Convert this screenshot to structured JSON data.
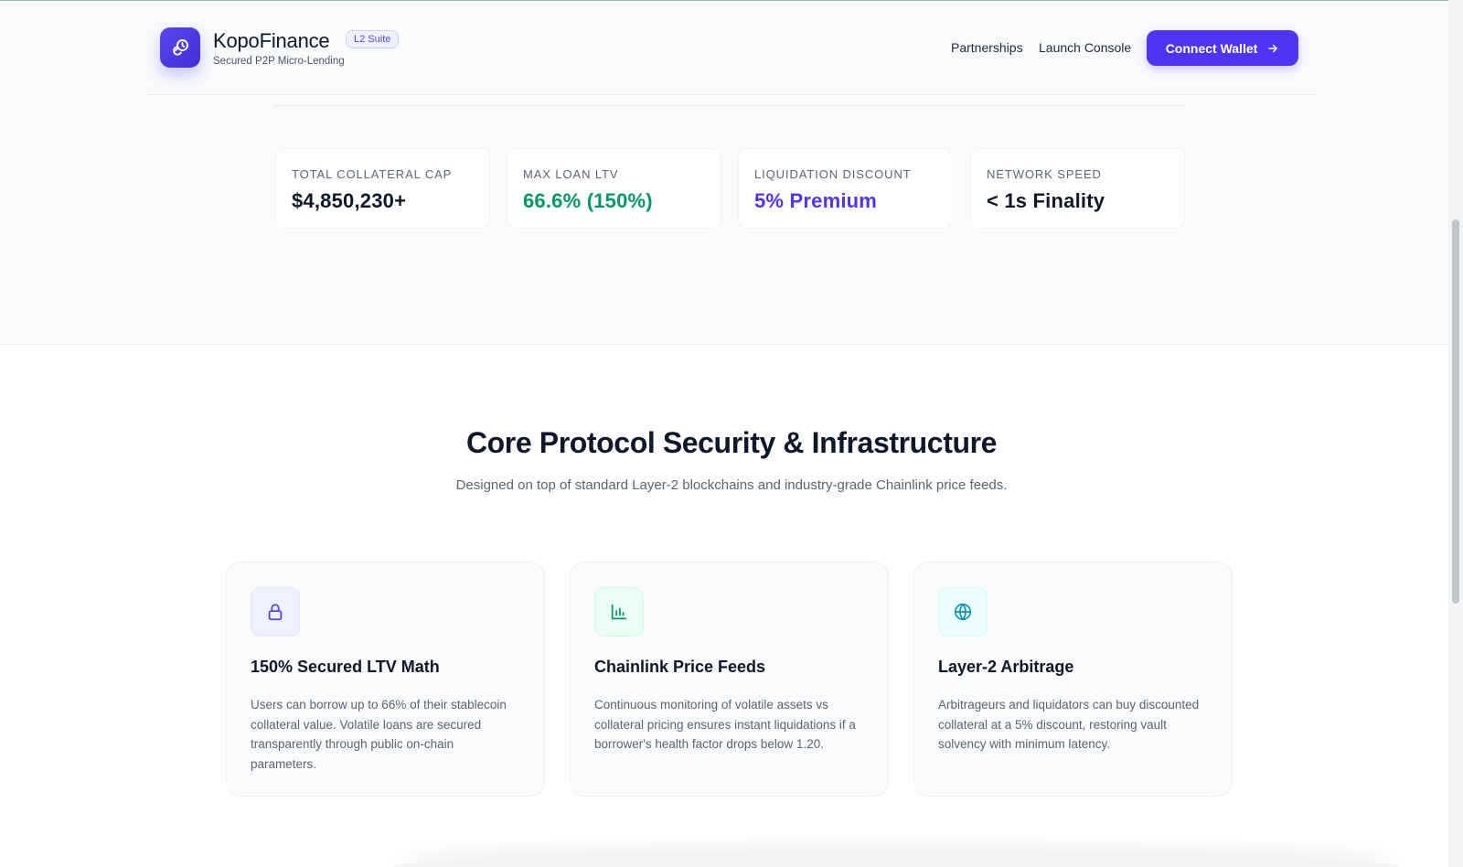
{
  "header": {
    "brand_name": "KopoFinance",
    "brand_badge": "L2 Suite",
    "tagline": "Secured P2P Micro-Lending",
    "logo_icon": "link-clock-icon",
    "nav": {
      "partnerships": "Partnerships",
      "launch_console": "Launch Console"
    },
    "connect_label": "Connect Wallet",
    "connect_icon": "arrow-right-icon"
  },
  "stats": [
    {
      "label": "TOTAL COLLATERAL CAP",
      "value": "$4,850,230+",
      "color": "#0f172a"
    },
    {
      "label": "MAX LOAN LTV",
      "value": "66.6% (150%)",
      "color": "#059669"
    },
    {
      "label": "LIQUIDATION DISCOUNT",
      "value": "5% Premium",
      "color": "#4f35f3"
    },
    {
      "label": "NETWORK SPEED",
      "value": "< 1s Finality",
      "color": "#0f172a"
    }
  ],
  "section": {
    "title": "Core Protocol Security & Infrastructure",
    "subtitle": "Designed on top of standard Layer-2 blockchains and industry-grade Chainlink price feeds."
  },
  "features": [
    {
      "icon": "lock-icon",
      "icon_color": "#4f46e5",
      "icon_bg": "#eef2ff",
      "title": "150% Secured LTV Math",
      "desc": "Users can borrow up to 66% of their stablecoin collateral value. Volatile loans are secured transparently through public on-chain parameters."
    },
    {
      "icon": "bar-chart-icon",
      "icon_color": "#059669",
      "icon_bg": "#ecfdf5",
      "title": "Chainlink Price Feeds",
      "desc": "Continuous monitoring of volatile assets vs collateral pricing ensures instant liquidations if a borrower's health factor drops below 1.20."
    },
    {
      "icon": "globe-icon",
      "icon_color": "#0891b2",
      "icon_bg": "#ecfeff",
      "title": "Layer-2 Arbitrage",
      "desc": "Arbitrageurs and liquidators can buy discounted collateral at a 5% discount, restoring vault solvency with minimum latency."
    }
  ],
  "colors": {
    "brand": "#4f35f3",
    "success": "#059669",
    "text": "#0f172a",
    "muted": "#5b6473"
  }
}
